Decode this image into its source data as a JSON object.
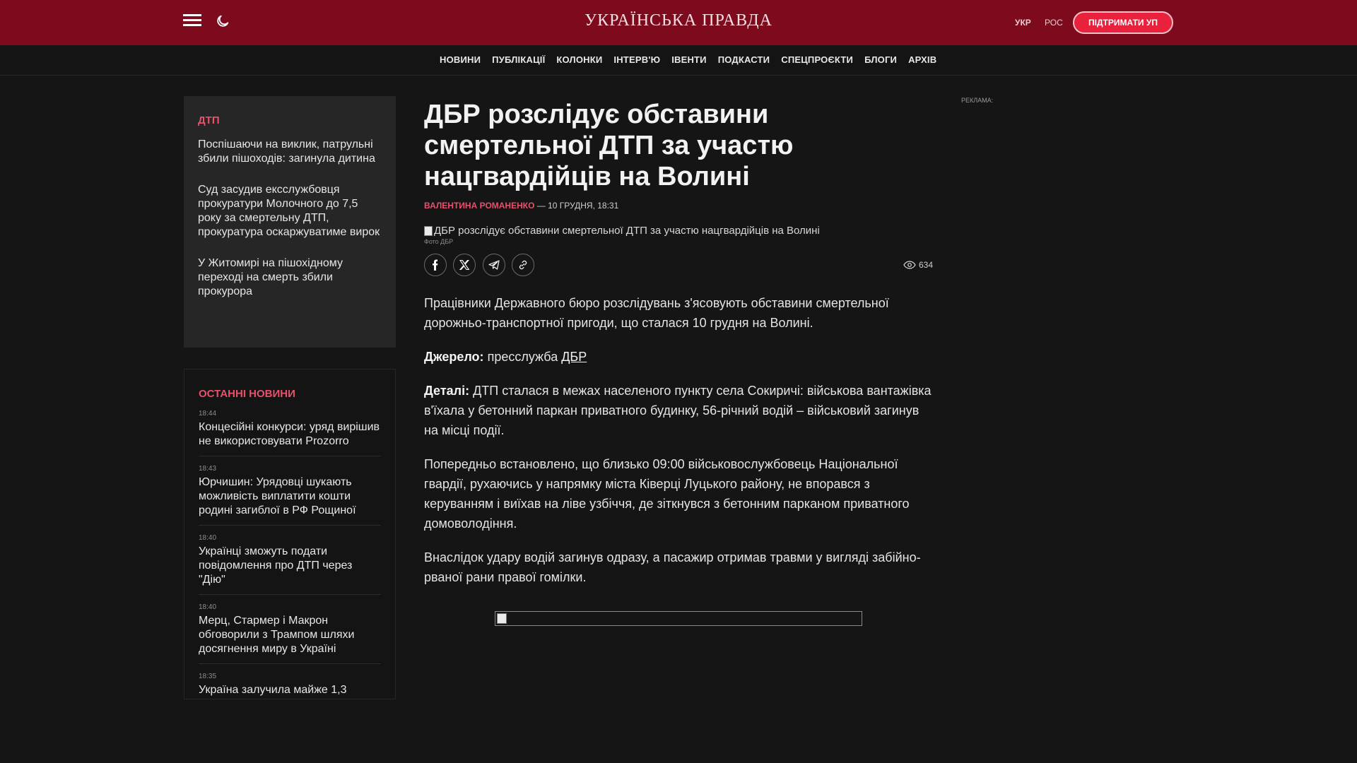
{
  "header": {
    "logo": "УКРАЇНСЬКА ПРАВДА",
    "lang_ukr": "УКР",
    "lang_ros": "РОС",
    "support": "ПІДТРИМАТИ УП",
    "brand_color": "#7e0a1e",
    "accent_color": "#e8223c"
  },
  "nav": {
    "items": [
      "НОВИНИ",
      "ПУБЛІКАЦІЇ",
      "КОЛОНКИ",
      "ІНТЕРВ'Ю",
      "ІВЕНТИ",
      "ПОДКАСТИ",
      "СПЕЦПРОЄКТИ",
      "БЛОГИ",
      "АРХІВ"
    ]
  },
  "sidebar": {
    "tag": "ДТП",
    "links": [
      "Поспішаючи на виклик, патрульні збили пішоходів: загинула дитина",
      "Суд засудив ексслужбовця прокуратури Молочного до 7,5 року за смертельну ДТП, прокуратура оскаржуватиме вирок",
      "У Житомирі на пішохідному переході на смерть збили прокурора"
    ]
  },
  "latest": {
    "title": "ОСТАННІ НОВИНИ",
    "items": [
      {
        "time": "18:44",
        "title": "Концесійні конкурси: уряд вирішив не використовувати Prozorro"
      },
      {
        "time": "18:43",
        "title": "Юрчишин: Урядовці шукають можливість виплатити кошти родині загиблої в РФ Рощиної"
      },
      {
        "time": "18:40",
        "title": "Українці зможуть подати повідомлення про ДТП через \"Дію\""
      },
      {
        "time": "18:40",
        "title": "Мерц, Стармер і Макрон обговорили з Трампом шляхи досягнення миру в Україні"
      },
      {
        "time": "18:35",
        "title": "Україна залучила майже 1,3"
      }
    ]
  },
  "article": {
    "title": "ДБР розслідує обставини смертельної ДТП за участю нацгвардійців на Волині",
    "author": "ВАЛЕНТИНА РОМАНЕНКО",
    "date": "— 10 ГРУДНЯ, 18:31",
    "photo_alt": "ДБР розслідує обставини смертельної ДТП за участю нацгвардійців на Волині",
    "photo_credit": "Фото ДБР",
    "views": "634",
    "p1": "Працівники Державного бюро розслідувань з'ясовують обставини смертельної дорожньо-транспортної пригоди, що сталася 10 грудня на Волині.",
    "source_label": "Джерело:",
    "source_text": "пресслужба",
    "source_link": "ДБР",
    "details_label": "Деталі:",
    "details_text": "ДТП сталася в межах населеного пункту села Сокиричі: військова вантажівка в'їхала у бетонний паркан приватного будинку, 56-річний водій – військовий загинув на місці події.",
    "p4": "Попередньо встановлено, що близько 09:00 військовослужбовець Національної гвардії, рухаючись у напрямку міста Ківерці Луцького району, не впорався з керуванням і виїхав на ліве узбіччя, де зіткнувся з бетонним парканом приватного домоволодіння.",
    "p5": "Внаслідок удару водій загинув одразу, а пасажир отримав травми у вигляді забійно-рваної рани правої гомілки."
  },
  "ad": {
    "label": "РЕКЛАМА:"
  }
}
